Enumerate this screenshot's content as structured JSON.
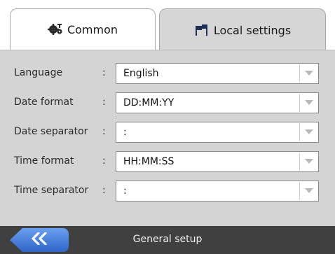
{
  "tabs": [
    {
      "label": "Common",
      "icon": "gears-icon",
      "active": false
    },
    {
      "label": "Local settings",
      "icon": "flags-icon",
      "active": true
    }
  ],
  "settings": [
    {
      "label": "Language",
      "value": "English"
    },
    {
      "label": "Date format",
      "value": "DD:MM:YY"
    },
    {
      "label": "Date separator",
      "value": ":"
    },
    {
      "label": "Time format",
      "value": "HH:MM:SS"
    },
    {
      "label": "Time separator",
      "value": ":"
    }
  ],
  "separator_glyph": ":",
  "footer": {
    "title": "General setup",
    "back_icon": "double-chevron-left-icon"
  },
  "colors": {
    "panel": "#d4d4d4",
    "footer": "#404040",
    "back_button": "#3f78dc"
  }
}
